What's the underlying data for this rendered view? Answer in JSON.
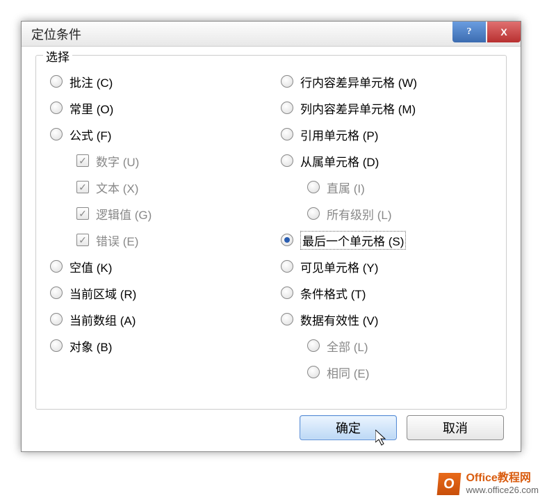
{
  "titlebar": {
    "title": "定位条件"
  },
  "group": {
    "label": "选择"
  },
  "left": {
    "comments": "批注 (C)",
    "constants": "常里 (O)",
    "formulas": "公式 (F)",
    "numbers": "数字 (U)",
    "text": "文本 (X)",
    "logical": "逻辑值 (G)",
    "errors": "错误 (E)",
    "blanks": "空值 (K)",
    "current_region": "当前区域 (R)",
    "current_array": "当前数组 (A)",
    "objects": "对象 (B)"
  },
  "right": {
    "row_diff": "行内容差异单元格 (W)",
    "col_diff": "列内容差异单元格 (M)",
    "precedents": "引用单元格 (P)",
    "dependents": "从属单元格 (D)",
    "direct": "直属 (I)",
    "all_levels": "所有级别 (L)",
    "last_cell": "最后一个单元格 (S)",
    "visible": "可见单元格 (Y)",
    "cond_format": "条件格式 (T)",
    "data_valid": "数据有效性 (V)",
    "all": "全部 (L)",
    "same": "相同 (E)"
  },
  "buttons": {
    "ok": "确定",
    "cancel": "取消"
  },
  "watermark": {
    "logo": "O",
    "line1": "Office教程网",
    "line2": "www.office26.com"
  }
}
